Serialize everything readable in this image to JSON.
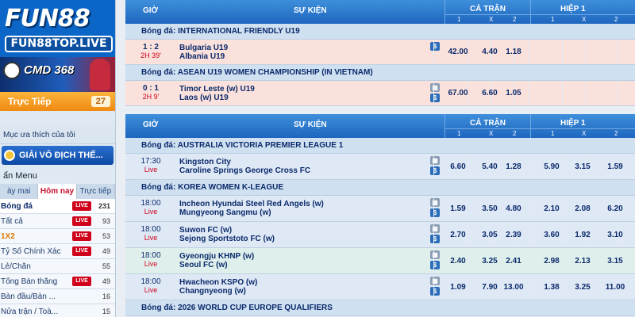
{
  "sidebar": {
    "logo_main": "FUN88",
    "logo_sub": "FUN88TOP.LIVE",
    "banner_text": "CMD 368",
    "live_label": "Trực Tiếp",
    "live_count": "27",
    "favorites_label": "Mục ưa thích của tôi",
    "tournament_label": "GIẢI VÔ ĐỊCH THẾ...",
    "menu_label": "ẩn Menu",
    "tabs": [
      "ày mai",
      "Hôm nay",
      "Trực tiếp"
    ],
    "active_tab": "Hôm nay",
    "sports": [
      {
        "name": "Bóng đá",
        "live": "LIVE",
        "count": "231"
      },
      {
        "name": "Tất cả",
        "live": "LIVE",
        "count": "93"
      },
      {
        "name": "1X2",
        "live": "LIVE",
        "count": "53"
      },
      {
        "name": "Tỷ Số Chính Xác",
        "live": "LIVE",
        "count": "49"
      },
      {
        "name": "Lẻ/Chẵn",
        "live": "",
        "count": "55"
      },
      {
        "name": "Tổng Bàn thắng",
        "live": "LIVE",
        "count": "49"
      },
      {
        "name": "Bàn đầu/Bàn ...",
        "live": "",
        "count": "16"
      },
      {
        "name": "Nửa trận / Toà...",
        "live": "",
        "count": "15"
      }
    ]
  },
  "table_header": {
    "time": "GIỜ",
    "event": "SỰ KIỆN",
    "full_match": "CẢ TRẬN",
    "half": "HIỆP 1",
    "sub": [
      "1",
      "X",
      "2",
      "1",
      "X",
      "2"
    ]
  },
  "live_section": {
    "leagues": [
      {
        "name": "Bóng đá: INTERNATIONAL FRIENDLY U19",
        "matches": [
          {
            "time1": "1 : 2",
            "time2": "2H 39'",
            "home": "Bulgaria U19",
            "away": "Albania U19",
            "odds": [
              "42.00",
              "4.40",
              "1.18",
              "",
              "",
              ""
            ]
          }
        ]
      },
      {
        "name": "Bóng đá: ASEAN U19 WOMEN CHAMPIONSHIP (IN VIETNAM)",
        "matches": [
          {
            "time1": "0 : 1",
            "time2": "2H 9'",
            "home": "Timor Leste (w) U19",
            "away": "Laos (w) U19",
            "odds": [
              "67.00",
              "6.60",
              "1.05",
              "",
              "",
              ""
            ]
          }
        ]
      }
    ]
  },
  "prematch_section": {
    "leagues": [
      {
        "name": "Bóng đá: AUSTRALIA VICTORIA PREMIER LEAGUE 1",
        "matches": [
          {
            "time1": "17:30",
            "time2": "Live",
            "home": "Kingston City",
            "away": "Caroline Springs George Cross FC",
            "odds": [
              "6.60",
              "5.40",
              "1.28",
              "5.90",
              "3.15",
              "1.59"
            ]
          }
        ]
      },
      {
        "name": "Bóng đá: KOREA WOMEN K-LEAGUE",
        "matches": [
          {
            "time1": "18:00",
            "time2": "Live",
            "home": "Incheon Hyundai Steel Red Angels (w)",
            "away": "Mungyeong Sangmu (w)",
            "odds": [
              "1.59",
              "3.50",
              "4.80",
              "2.10",
              "2.08",
              "6.20"
            ]
          },
          {
            "time1": "18:00",
            "time2": "Live",
            "home": "Suwon FC (w)",
            "away": "Sejong Sportstoto FC (w)",
            "odds": [
              "2.70",
              "3.05",
              "2.39",
              "3.60",
              "1.92",
              "3.10"
            ]
          },
          {
            "time1": "18:00",
            "time2": "Live",
            "home": "Gyeongju KHNP (w)",
            "away": "Seoul FC (w)",
            "odds": [
              "2.40",
              "3.25",
              "2.41",
              "2.98",
              "2.13",
              "3.15"
            ]
          },
          {
            "time1": "18:00",
            "time2": "Live",
            "home": "Hwacheon KSPO (w)",
            "away": "Changnyeong (w)",
            "odds": [
              "1.09",
              "7.90",
              "13.00",
              "1.38",
              "3.25",
              "11.00"
            ]
          }
        ]
      },
      {
        "name": "Bóng đá: 2026 WORLD CUP EUROPE QUALIFIERS",
        "matches": []
      }
    ]
  }
}
